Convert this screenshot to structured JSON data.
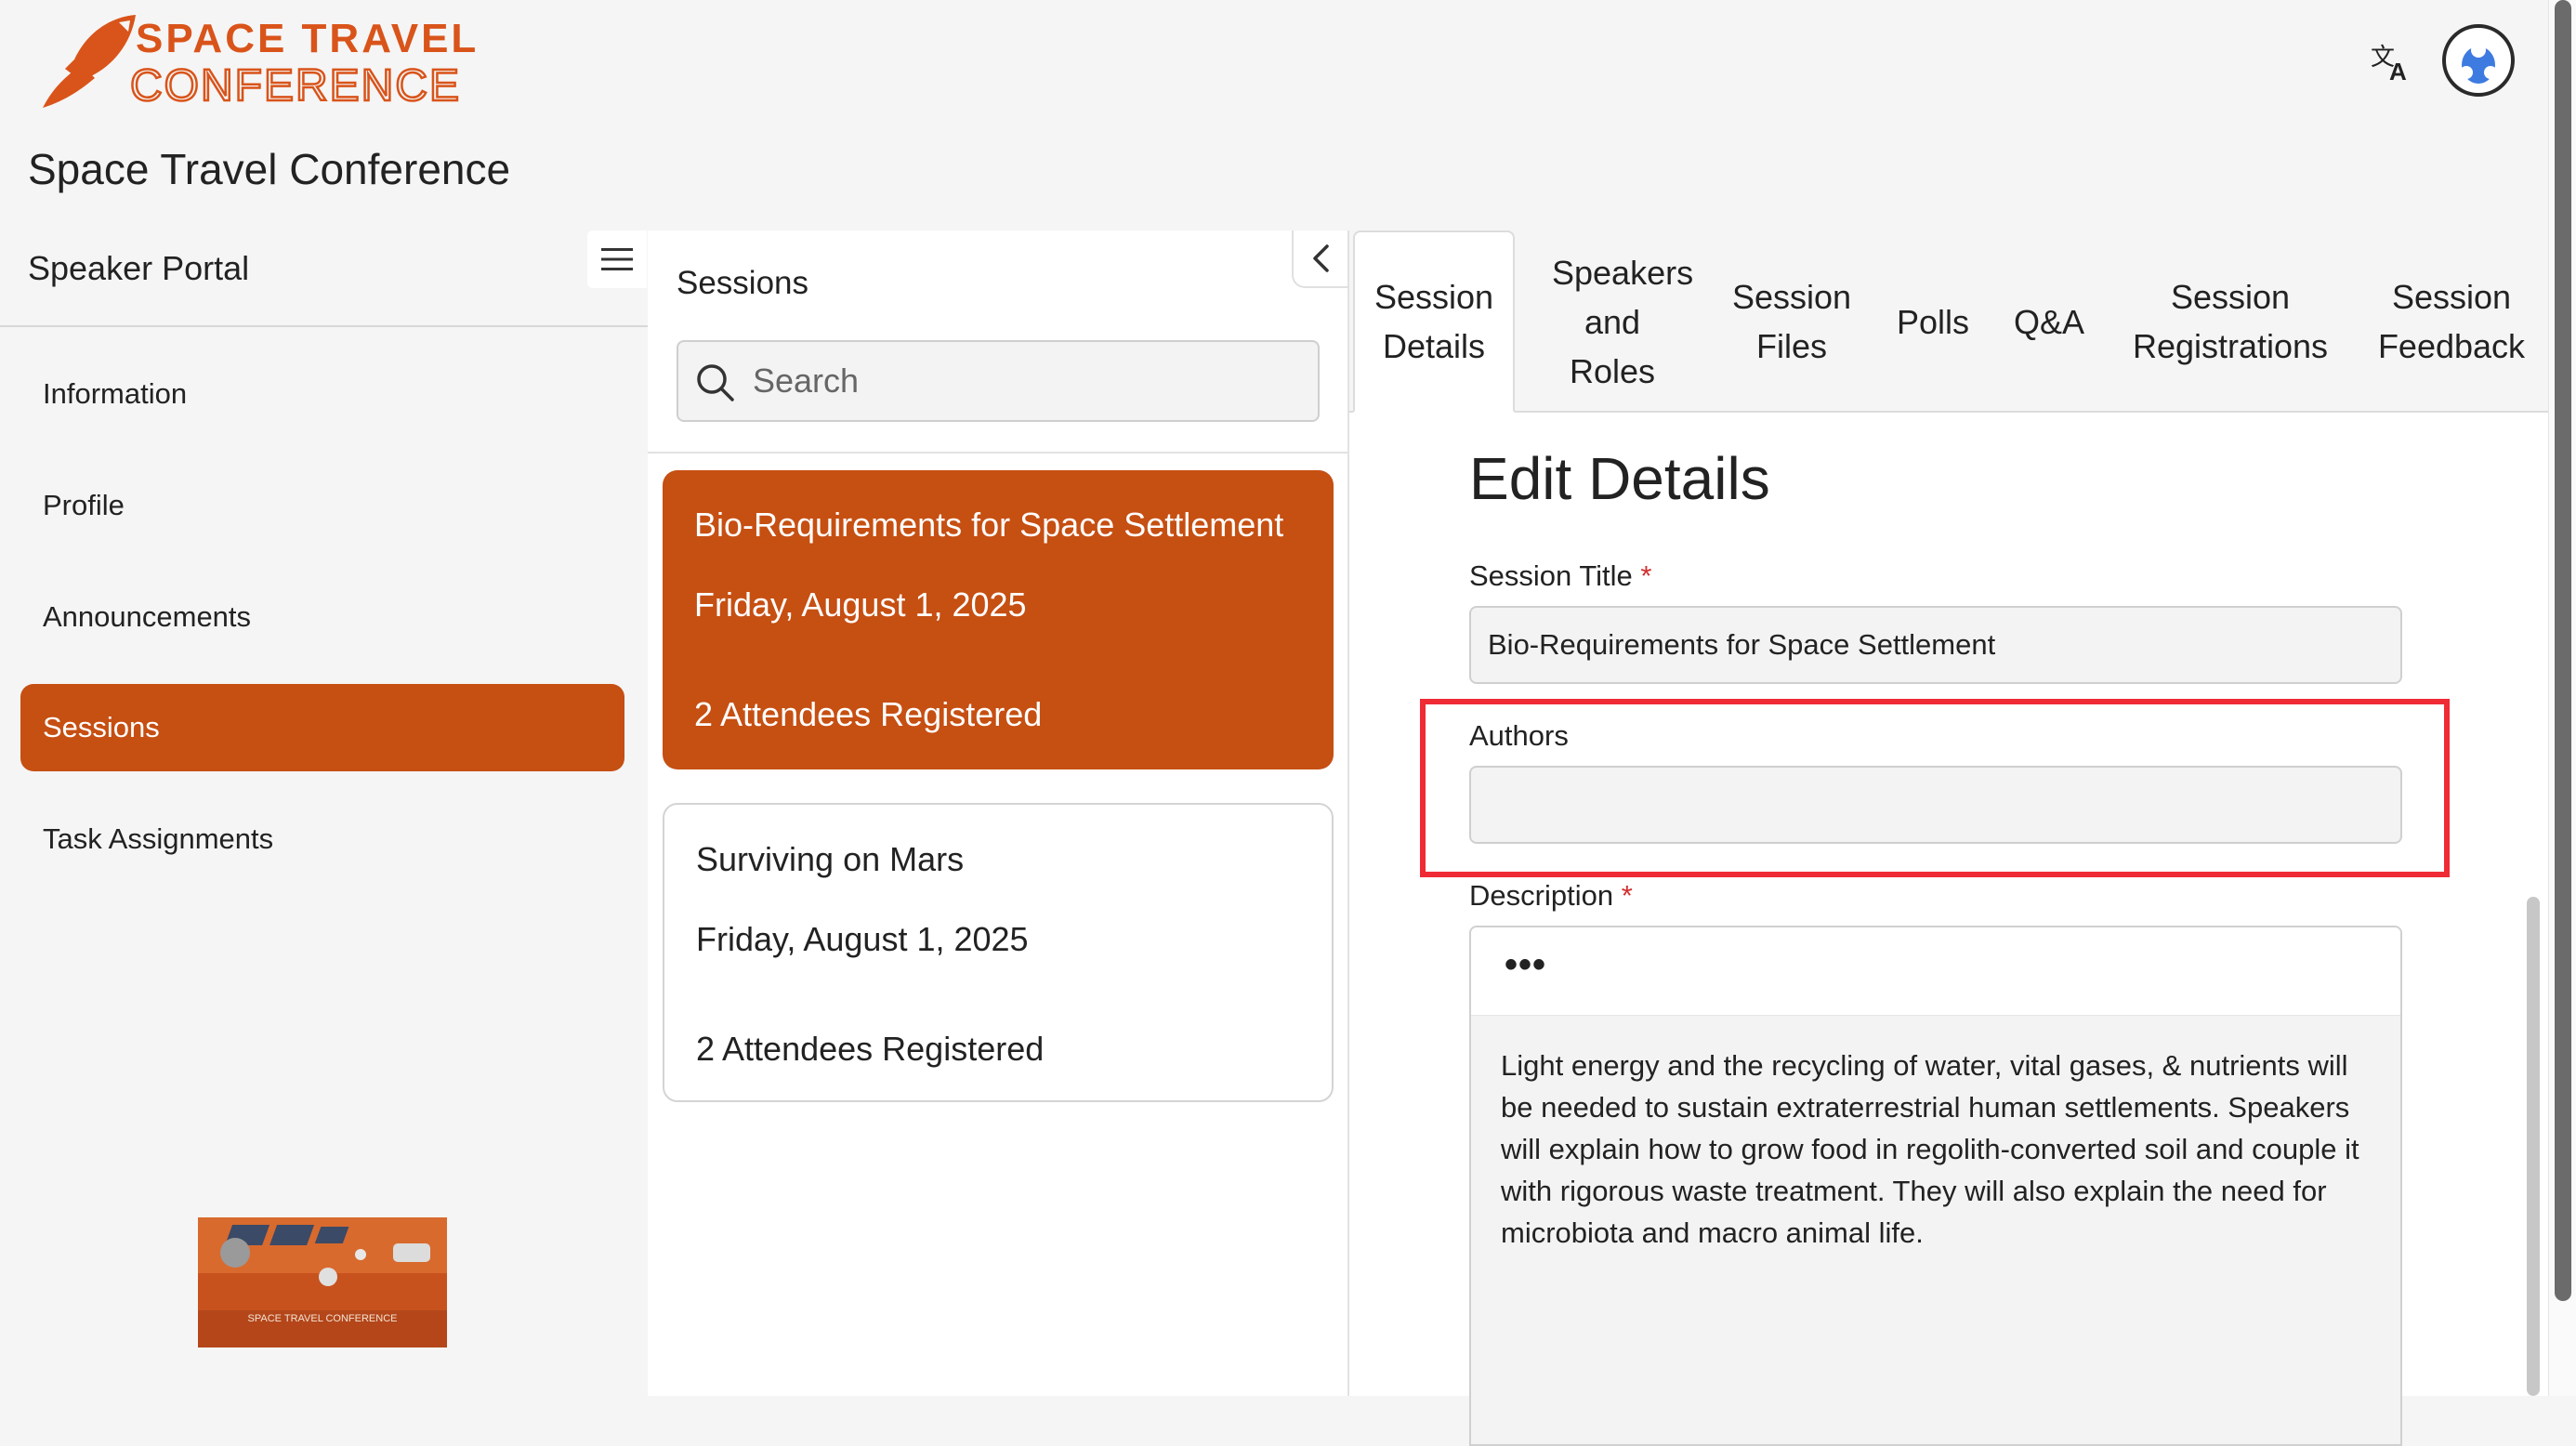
{
  "header": {
    "logo_text_line1": "SPACE TRAVEL",
    "logo_text_line2": "CONFERENCE",
    "app_title": "Space Travel Conference",
    "translate_icon": "translate-icon",
    "avatar_icon": "user-avatar-icon"
  },
  "sidebar": {
    "title": "Speaker Portal",
    "menu_icon": "hamburger-menu-icon",
    "items": [
      {
        "label": "Information"
      },
      {
        "label": "Profile"
      },
      {
        "label": "Announcements"
      },
      {
        "label": "Sessions"
      },
      {
        "label": "Task Assignments"
      }
    ],
    "active_index": 3,
    "image_caption": "SPACE TRAVEL CONFERENCE"
  },
  "sessions": {
    "title": "Sessions",
    "search_placeholder": "Search",
    "collapse_icon": "chevron-left-icon",
    "cards": [
      {
        "title": "Bio-Requirements for Space Settlement",
        "date": "Friday, August 1, 2025",
        "attendees": "2 Attendees Registered",
        "active": true
      },
      {
        "title": "Surviving on Mars",
        "date": "Friday, August 1, 2025",
        "attendees": "2 Attendees Registered",
        "active": false
      }
    ]
  },
  "tabs": [
    {
      "label": "Session Details"
    },
    {
      "label": "Speakers and Roles"
    },
    {
      "label": "Session Files"
    },
    {
      "label": "Polls"
    },
    {
      "label": "Q&A"
    },
    {
      "label": "Session Registrations"
    },
    {
      "label": "Session Feedback"
    }
  ],
  "form": {
    "heading": "Edit Details",
    "session_title_label": "Session Title",
    "session_title_value": "Bio-Requirements for Space Settlement",
    "required_mark": "*",
    "authors_label": "Authors",
    "authors_value": "",
    "description_label": "Description",
    "editor_more": "•••",
    "description_text": "Light energy and the recycling of water, vital gases, & nutrients will be needed to sustain extraterrestrial human settlements. Speakers will explain how to grow food in regolith-converted soil and couple it with rigorous waste treatment. They will also explain the need for microbiota and macro animal life."
  },
  "colors": {
    "accent": "#c64f12",
    "highlight": "#ef2b35",
    "required": "#d32f2f"
  }
}
